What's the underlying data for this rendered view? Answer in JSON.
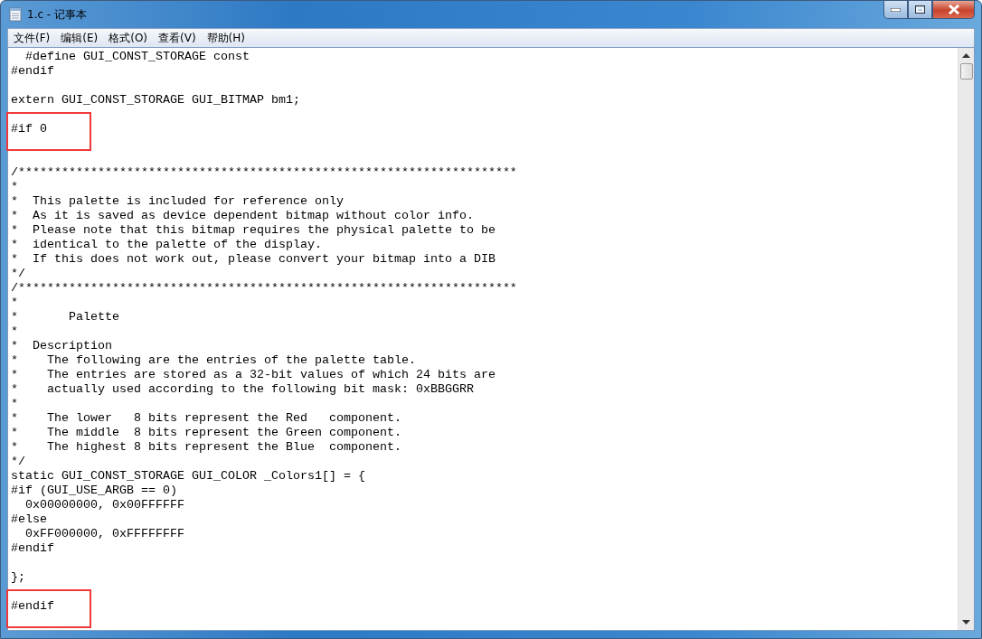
{
  "window": {
    "title": "1.c - 记事本"
  },
  "menu": [
    "文件(F)",
    "编辑(E)",
    "格式(O)",
    "查看(V)",
    "帮助(H)"
  ],
  "lines": [
    {
      "kind": "code",
      "text": "  #define GUI_CONST_STORAGE const",
      "boxed": false
    },
    {
      "kind": "code",
      "text": "#endif",
      "boxed": false
    },
    {
      "kind": "blank"
    },
    {
      "kind": "code",
      "text": "extern GUI_CONST_STORAGE GUI_BITMAP bm1;",
      "boxed": false
    },
    {
      "kind": "blank"
    },
    {
      "kind": "code",
      "text": "#if 0",
      "boxed": true
    },
    {
      "kind": "blank"
    },
    {
      "kind": "blank"
    },
    {
      "kind": "code",
      "text": "/*********************************************************************",
      "boxed": false
    },
    {
      "kind": "code",
      "text": "*",
      "boxed": false
    },
    {
      "kind": "code",
      "text": "*  This palette is included for reference only",
      "boxed": false
    },
    {
      "kind": "code",
      "text": "*  As it is saved as device dependent bitmap without color info.",
      "boxed": false
    },
    {
      "kind": "code",
      "text": "*  Please note that this bitmap requires the physical palette to be",
      "boxed": false
    },
    {
      "kind": "code",
      "text": "*  identical to the palette of the display.",
      "boxed": false
    },
    {
      "kind": "code",
      "text": "*  If this does not work out, please convert your bitmap into a DIB",
      "boxed": false
    },
    {
      "kind": "code",
      "text": "*/",
      "boxed": false
    },
    {
      "kind": "code",
      "text": "/*********************************************************************",
      "boxed": false
    },
    {
      "kind": "code",
      "text": "*",
      "boxed": false
    },
    {
      "kind": "code",
      "text": "*       Palette",
      "boxed": false
    },
    {
      "kind": "code",
      "text": "*",
      "boxed": false
    },
    {
      "kind": "code",
      "text": "*  Description",
      "boxed": false
    },
    {
      "kind": "code",
      "text": "*    The following are the entries of the palette table.",
      "boxed": false
    },
    {
      "kind": "code",
      "text": "*    The entries are stored as a 32-bit values of which 24 bits are",
      "boxed": false
    },
    {
      "kind": "code",
      "text": "*    actually used according to the following bit mask: 0xBBGGRR",
      "boxed": false
    },
    {
      "kind": "code",
      "text": "*",
      "boxed": false
    },
    {
      "kind": "code",
      "text": "*    The lower   8 bits represent the Red   component.",
      "boxed": false
    },
    {
      "kind": "code",
      "text": "*    The middle  8 bits represent the Green component.",
      "boxed": false
    },
    {
      "kind": "code",
      "text": "*    The highest 8 bits represent the Blue  component.",
      "boxed": false
    },
    {
      "kind": "code",
      "text": "*/",
      "boxed": false
    },
    {
      "kind": "code",
      "text": "static GUI_CONST_STORAGE GUI_COLOR _Colors1[] = {",
      "boxed": false
    },
    {
      "kind": "code",
      "text": "#if (GUI_USE_ARGB == 0)",
      "boxed": false
    },
    {
      "kind": "code",
      "text": "  0x00000000, 0x00FFFFFF",
      "boxed": false
    },
    {
      "kind": "code",
      "text": "#else",
      "boxed": false
    },
    {
      "kind": "code",
      "text": "  0xFF000000, 0xFFFFFFFF",
      "boxed": false
    },
    {
      "kind": "code",
      "text": "#endif",
      "boxed": false
    },
    {
      "kind": "blank"
    },
    {
      "kind": "code",
      "text": "};",
      "boxed": false
    },
    {
      "kind": "blank"
    },
    {
      "kind": "code",
      "text": "#endif",
      "boxed": true
    }
  ]
}
